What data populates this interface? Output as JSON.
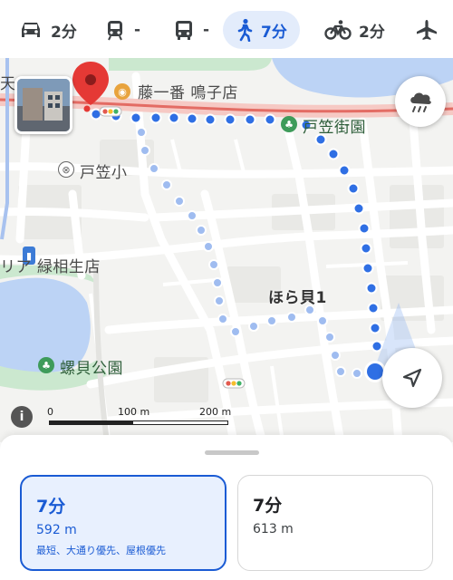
{
  "modes": [
    {
      "icon": "car-icon",
      "label": "2分"
    },
    {
      "icon": "train-icon",
      "label": "-"
    },
    {
      "icon": "bus-icon",
      "label": "-"
    },
    {
      "icon": "walk-icon",
      "label": "7分",
      "active": true
    },
    {
      "icon": "bicycle-icon",
      "label": "2分"
    },
    {
      "icon": "plane-icon",
      "label": ""
    }
  ],
  "map": {
    "labels": {
      "restaurant": "藤一番 鳴子店",
      "park_tokasa_street": "戸笠街園",
      "school": "戸笠小",
      "store": "リア 緑相生店",
      "horagai": "ほら貝1",
      "park_horagai": "螺貝公園",
      "edge_top_left": "天"
    },
    "scale": {
      "zero": "0",
      "mid": "100 m",
      "max": "200 m"
    },
    "info_label": "i"
  },
  "routes": [
    {
      "time": "7分",
      "distance": "592 m",
      "note": "最短、大通り優先、屋根優先",
      "selected": true
    },
    {
      "time": "7分",
      "distance": "613 m",
      "note": "",
      "selected": false
    }
  ],
  "colors": {
    "accent": "#1a5bd4",
    "route_primary": "#2f6fe4",
    "route_alt": "#9fbcf0",
    "water": "#bcd3f5",
    "park": "#cbe8cf",
    "main_road": "#f6c9c4"
  }
}
